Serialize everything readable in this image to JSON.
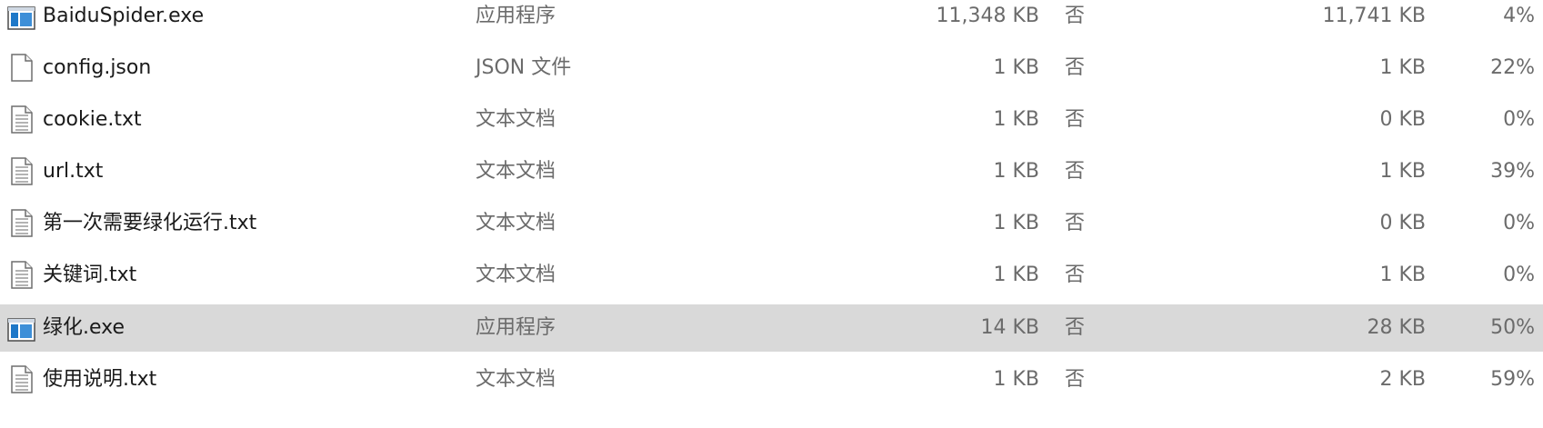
{
  "columns": {
    "name": "",
    "type": "",
    "size": "",
    "compressed": "",
    "packed_size": "",
    "ratio": ""
  },
  "files": [
    {
      "name": "BaiduSpider.exe",
      "icon": "executable-icon",
      "type": "应用程序",
      "size": "11,348 KB",
      "compressed": "否",
      "packed_size": "11,741 KB",
      "ratio": "4%",
      "selected": false
    },
    {
      "name": "config.json",
      "icon": "blank-file-icon",
      "type": "JSON 文件",
      "size": "1 KB",
      "compressed": "否",
      "packed_size": "1 KB",
      "ratio": "22%",
      "selected": false
    },
    {
      "name": "cookie.txt",
      "icon": "text-file-icon",
      "type": "文本文档",
      "size": "1 KB",
      "compressed": "否",
      "packed_size": "0 KB",
      "ratio": "0%",
      "selected": false
    },
    {
      "name": "url.txt",
      "icon": "text-file-icon",
      "type": "文本文档",
      "size": "1 KB",
      "compressed": "否",
      "packed_size": "1 KB",
      "ratio": "39%",
      "selected": false
    },
    {
      "name": "第一次需要绿化运行.txt",
      "icon": "text-file-icon",
      "type": "文本文档",
      "size": "1 KB",
      "compressed": "否",
      "packed_size": "0 KB",
      "ratio": "0%",
      "selected": false
    },
    {
      "name": "关键词.txt",
      "icon": "text-file-icon",
      "type": "文本文档",
      "size": "1 KB",
      "compressed": "否",
      "packed_size": "1 KB",
      "ratio": "0%",
      "selected": false
    },
    {
      "name": "绿化.exe",
      "icon": "executable-icon",
      "type": "应用程序",
      "size": "14 KB",
      "compressed": "否",
      "packed_size": "28 KB",
      "ratio": "50%",
      "selected": true
    },
    {
      "name": "使用说明.txt",
      "icon": "text-file-icon",
      "type": "文本文档",
      "size": "1 KB",
      "compressed": "否",
      "packed_size": "2 KB",
      "ratio": "59%",
      "selected": false
    }
  ],
  "colors": {
    "selection": "#d9d9d9",
    "exe_accent": "#1e78c8",
    "secondary_text": "#6b6b6b"
  }
}
